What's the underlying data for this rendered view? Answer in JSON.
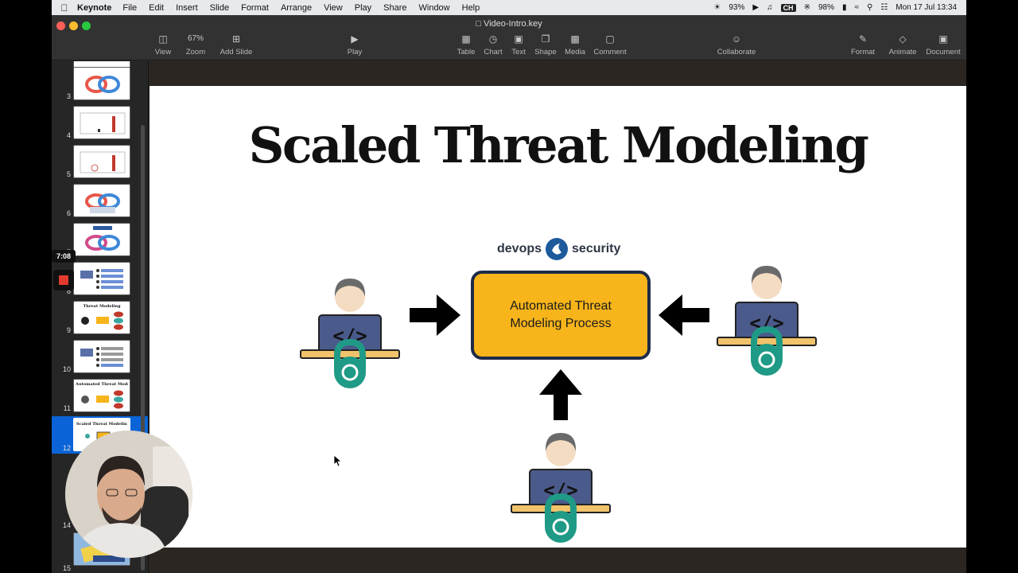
{
  "menubar": {
    "app_name": "Keynote",
    "items": [
      "File",
      "Edit",
      "Insert",
      "Slide",
      "Format",
      "Arrange",
      "View",
      "Play",
      "Share",
      "Window",
      "Help"
    ],
    "battery_1": "93%",
    "input_source": "CH",
    "battery_2": "98%",
    "datetime": "Mon 17 Jul  13:34"
  },
  "window": {
    "title": "Video-Intro.key"
  },
  "toolbar": {
    "view": "View",
    "zoom_value": "67%",
    "zoom": "Zoom",
    "add_slide": "Add Slide",
    "play": "Play",
    "table": "Table",
    "chart": "Chart",
    "text": "Text",
    "shape": "Shape",
    "media": "Media",
    "comment": "Comment",
    "collaborate": "Collaborate",
    "format": "Format",
    "animate": "Animate",
    "document": "Document"
  },
  "navigator": {
    "timer": "7:08",
    "slides": [
      {
        "number": "3",
        "title": ""
      },
      {
        "number": "4",
        "title": ""
      },
      {
        "number": "5",
        "title": ""
      },
      {
        "number": "6",
        "title": ""
      },
      {
        "number": "7",
        "title": ""
      },
      {
        "number": "8",
        "title": ""
      },
      {
        "number": "9",
        "title": "Threat Modeling"
      },
      {
        "number": "10",
        "title": ""
      },
      {
        "number": "11",
        "title": "Automated Threat Modeling"
      },
      {
        "number": "12",
        "title": "Scaled Threat Modeling"
      },
      {
        "number": "14",
        "title": ""
      },
      {
        "number": "15",
        "title": ""
      }
    ]
  },
  "slide": {
    "title": "Scaled Threat Modeling",
    "logo_left": "devops",
    "logo_right": "security",
    "process_label": "Automated Threat Modeling Process"
  },
  "colors": {
    "process_fill": "#f7b51b",
    "process_border": "#1e2b47",
    "lock": "#1f9a86",
    "laptop": "#4a5a8a",
    "selection": "#0a64d8",
    "record": "#e23b2e"
  }
}
